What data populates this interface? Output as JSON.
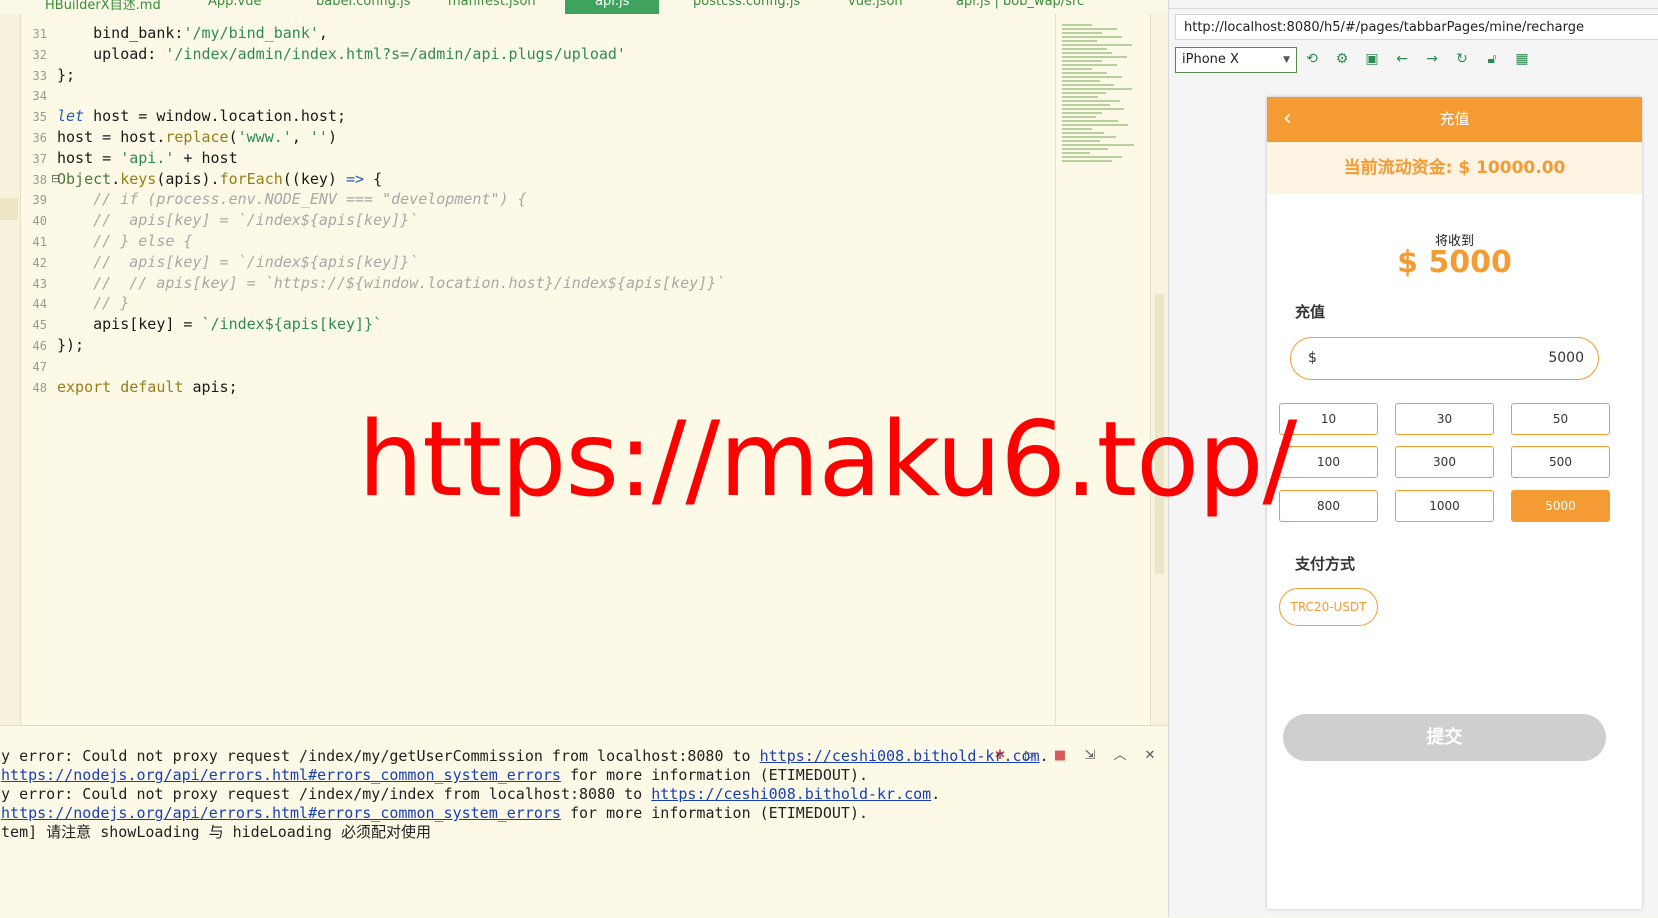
{
  "tabs": [
    {
      "label": "HBuilderX自述.md",
      "active": false
    },
    {
      "label": "App.vue",
      "active": false
    },
    {
      "label": "babel.config.js",
      "active": false
    },
    {
      "label": "manifest.json",
      "active": false
    },
    {
      "label": "api.js",
      "active": true
    },
    {
      "label": "postcss.config.js",
      "active": false
    },
    {
      "label": "vue.json",
      "active": false
    },
    {
      "label": "api.js | bob_wap/src",
      "active": false
    }
  ],
  "code_lines": [
    {
      "num": "31",
      "segs": [
        {
          "t": "    bind_bank:",
          "c": "code"
        },
        {
          "t": "'/my/bind_bank'",
          "c": "str"
        },
        {
          "t": ",",
          "c": "code"
        }
      ]
    },
    {
      "num": "32",
      "segs": [
        {
          "t": "    upload: ",
          "c": "code"
        },
        {
          "t": "'/index/admin/index.html?s=/admin/api.plugs/upload'",
          "c": "str"
        }
      ]
    },
    {
      "num": "33",
      "segs": [
        {
          "t": "};",
          "c": "code"
        }
      ]
    },
    {
      "num": "34",
      "segs": []
    },
    {
      "num": "35",
      "segs": [
        {
          "t": "let",
          "c": "kw"
        },
        {
          "t": " host = window.location.host;",
          "c": "code"
        }
      ]
    },
    {
      "num": "36",
      "segs": [
        {
          "t": "host = host.",
          "c": "code"
        },
        {
          "t": "replace",
          "c": "fn"
        },
        {
          "t": "(",
          "c": "code"
        },
        {
          "t": "'www.'",
          "c": "str"
        },
        {
          "t": ", ",
          "c": "code"
        },
        {
          "t": "''",
          "c": "str"
        },
        {
          "t": ")",
          "c": "code"
        }
      ]
    },
    {
      "num": "37",
      "segs": [
        {
          "t": "host = ",
          "c": "code"
        },
        {
          "t": "'api.'",
          "c": "str"
        },
        {
          "t": " + host",
          "c": "code"
        }
      ]
    },
    {
      "num": "38",
      "segs": [
        {
          "t": "Object",
          "c": "obj"
        },
        {
          "t": ".",
          "c": "code"
        },
        {
          "t": "keys",
          "c": "fn"
        },
        {
          "t": "(apis).",
          "c": "code"
        },
        {
          "t": "forEach",
          "c": "fn"
        },
        {
          "t": "((key) ",
          "c": "code"
        },
        {
          "t": "=>",
          "c": "kw"
        },
        {
          "t": " {",
          "c": "code"
        }
      ]
    },
    {
      "num": "39",
      "segs": [
        {
          "t": "    // if (process.env.NODE_ENV === \"development\") {",
          "c": "cmt"
        }
      ]
    },
    {
      "num": "40",
      "segs": [
        {
          "t": "    //  apis[key] = `/index${apis[key]}`",
          "c": "cmt"
        }
      ]
    },
    {
      "num": "41",
      "segs": [
        {
          "t": "    // } else {",
          "c": "cmt"
        }
      ]
    },
    {
      "num": "42",
      "segs": [
        {
          "t": "    //  apis[key] = `/index${apis[key]}`",
          "c": "cmt"
        }
      ]
    },
    {
      "num": "43",
      "segs": [
        {
          "t": "    //  // apis[key] = `https://${window.location.host}/index${apis[key]}`",
          "c": "cmt"
        }
      ]
    },
    {
      "num": "44",
      "segs": [
        {
          "t": "    // }",
          "c": "cmt"
        }
      ]
    },
    {
      "num": "45",
      "segs": [
        {
          "t": "    apis[key] = ",
          "c": "code"
        },
        {
          "t": "`/index${apis[key]}`",
          "c": "str"
        }
      ]
    },
    {
      "num": "46",
      "segs": [
        {
          "t": "});",
          "c": "code"
        }
      ]
    },
    {
      "num": "47",
      "segs": []
    },
    {
      "num": "48",
      "segs": [
        {
          "t": "export default",
          "c": "exp"
        },
        {
          "t": " apis;",
          "c": "code"
        }
      ]
    }
  ],
  "console": {
    "lines": [
      [
        {
          "t": "xy error: Could not proxy request /index/my/getUserCommission from localhost:8080 to "
        },
        {
          "t": "https://ceshi008.bithold-kr.com",
          "link": true
        },
        {
          "t": "."
        }
      ],
      [
        {
          "t": " "
        },
        {
          "t": "https://nodejs.org/api/errors.html#errors_common_system_errors",
          "link": true
        },
        {
          "t": " for more information (ETIMEDOUT)."
        }
      ],
      [
        {
          "t": "xy error: Could not proxy request /index/my/index from localhost:8080 to "
        },
        {
          "t": "https://ceshi008.bithold-kr.com",
          "link": true
        },
        {
          "t": "."
        }
      ],
      [
        {
          "t": " "
        },
        {
          "t": "https://nodejs.org/api/errors.html#errors_common_system_errors",
          "link": true
        },
        {
          "t": " for more information (ETIMEDOUT)."
        }
      ],
      [
        {
          "t": "stem] 请注意 showLoading 与 hideLoading 必须配对使用"
        }
      ]
    ],
    "tools": [
      "bug-icon",
      "run-icon",
      "stop-icon",
      "export-icon",
      "collapse-icon",
      "clear-icon"
    ]
  },
  "browser": {
    "url": "http://localhost:8080/h5/#/pages/tabbarPages/mine/recharge",
    "device": "iPhone X"
  },
  "phone": {
    "nav_back": "‹",
    "nav_title": "充值",
    "funds": "当前流动资金: $ 10000.00",
    "receive_label": "将收到",
    "receive_amount": "$ 5000",
    "recharge_label": "充值",
    "currency": "$",
    "amount_value": "5000",
    "amount_options": [
      "10",
      "30",
      "50",
      "100",
      "300",
      "500",
      "800",
      "1000",
      "5000"
    ],
    "selected_amount": "5000",
    "payment_label": "支付方式",
    "payment_method": "TRC20-USDT",
    "submit_label": "提交"
  },
  "watermark": "https://maku6.top/",
  "colors": {
    "accent": "#f49b33",
    "editor_bg": "#fcf9e7",
    "tab_active": "#3da35d",
    "link": "#1a3fb5"
  }
}
